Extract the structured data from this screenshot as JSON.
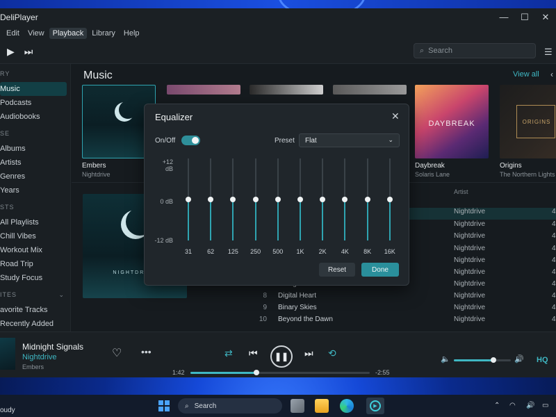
{
  "window": {
    "title": "DeliPlayer",
    "controls": [
      "—",
      "☐",
      "✕"
    ]
  },
  "menu": [
    "Edit",
    "View",
    "Playback",
    "Library",
    "Help"
  ],
  "menu_active": "Playback",
  "toolbar": {
    "play": "▶",
    "next": "⏭",
    "search_placeholder": "Search"
  },
  "sidebar": {
    "sections": [
      {
        "head": "RY",
        "items": [
          "Music",
          "Podcasts",
          "Audiobooks"
        ]
      },
      {
        "head": "SE",
        "items": [
          "Albums",
          "Artists",
          "Genres",
          "Years"
        ]
      },
      {
        "head": "STS",
        "items": [
          "All Playlists",
          "Chill Vibes",
          "Workout Mix",
          "Road Trip",
          "Study Focus"
        ]
      },
      {
        "head": "ITES",
        "items": [
          "avorite Tracks",
          "Recently Added"
        ]
      }
    ],
    "active": "Music"
  },
  "main": {
    "title": "Music",
    "view_all": "View all",
    "albums": [
      {
        "title": "Embers",
        "artist": "Nightdrive"
      },
      {
        "title": "",
        "artist": ""
      },
      {
        "title": "",
        "artist": ""
      },
      {
        "title": "",
        "artist": ""
      },
      {
        "title": "Daybreak",
        "artist": "Solaris Lane",
        "cover_text": "DAYBREAK"
      },
      {
        "title": "Origins",
        "artist": "The Northern Lights",
        "cover_text": "ORIGINS"
      }
    ],
    "big_art_text": "NIGHTDRIVE",
    "artist_col": "Artist",
    "tracks": [
      {
        "num": "",
        "title": "",
        "artist": "Nightdrive",
        "dur": "4:"
      },
      {
        "num": "",
        "title": "",
        "artist": "Nightdrive",
        "dur": "4:"
      },
      {
        "num": "",
        "title": "",
        "artist": "Nightdrive",
        "dur": "4:"
      },
      {
        "num": "",
        "title": "",
        "artist": "Nightdrive",
        "dur": "4:"
      },
      {
        "num": "",
        "title": "",
        "artist": "Nightdrive",
        "dur": "4:"
      },
      {
        "num": "",
        "title": "",
        "artist": "Nightdrive",
        "dur": "4:"
      },
      {
        "num": "7",
        "title": "Afterglow",
        "artist": "Nightdrive",
        "dur": "4:"
      },
      {
        "num": "8",
        "title": "Digital Heart",
        "artist": "Nightdrive",
        "dur": "4:"
      },
      {
        "num": "9",
        "title": "Binary Skies",
        "artist": "Nightdrive",
        "dur": "4:"
      },
      {
        "num": "10",
        "title": "Beyond the Dawn",
        "artist": "Nightdrive",
        "dur": "4:"
      }
    ]
  },
  "player": {
    "title": "Midnight Signals",
    "artist": "Nightdrive",
    "album": "Embers",
    "elapsed": "1:42",
    "remaining": "-2:55",
    "progress": 0.37,
    "volume": 0.7,
    "quality": "HQ"
  },
  "equalizer": {
    "title": "Equalizer",
    "onoff_label": "On/Off",
    "enabled": true,
    "preset_label": "Preset",
    "preset": "Flat",
    "db_top": "+12 dB",
    "db_mid": "0 dB",
    "db_bot": "-12 dB",
    "bands": [
      {
        "label": "31",
        "gain": 0
      },
      {
        "label": "62",
        "gain": 0
      },
      {
        "label": "125",
        "gain": 0
      },
      {
        "label": "250",
        "gain": 0
      },
      {
        "label": "500",
        "gain": 0
      },
      {
        "label": "1K",
        "gain": 0
      },
      {
        "label": "2K",
        "gain": 0
      },
      {
        "label": "4K",
        "gain": 0
      },
      {
        "label": "8K",
        "gain": 0
      },
      {
        "label": "16K",
        "gain": 0
      }
    ],
    "reset": "Reset",
    "done": "Done"
  },
  "taskbar": {
    "weather": "oudy",
    "search": "Search"
  },
  "colors": {
    "accent": "#3fb7c3",
    "done_button": "#2a8f9b",
    "toggle_on": "#2e8f9a"
  }
}
